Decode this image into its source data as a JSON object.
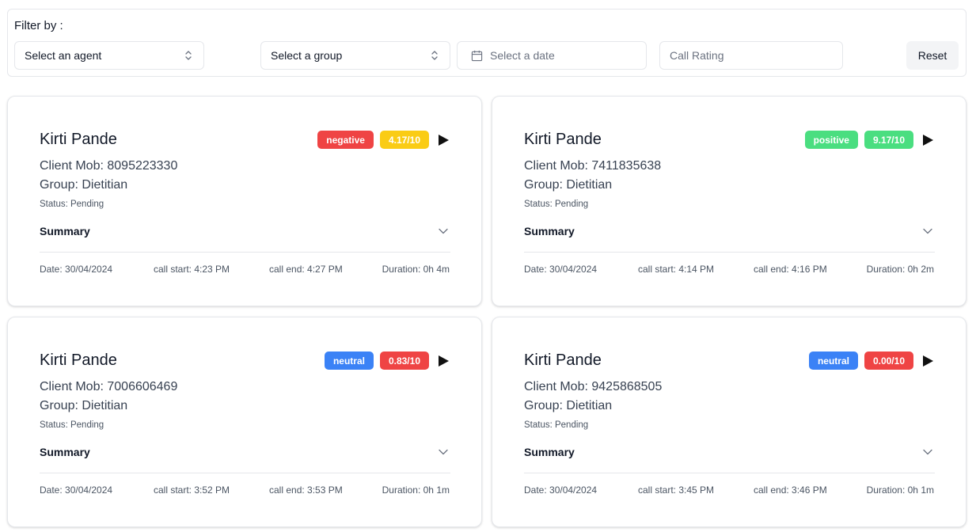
{
  "filters": {
    "label": "Filter by :",
    "agent_select": "Select an agent",
    "group_select": "Select a group",
    "date_placeholder": "Select a date",
    "rating_placeholder": "Call Rating",
    "reset_label": "Reset"
  },
  "colors": {
    "negative": "#ef4444",
    "positive": "#4ade80",
    "neutral": "#3b82f6",
    "rating_mid": "#facc15",
    "rating_high": "#4ade80",
    "rating_low": "#ef4444"
  },
  "cards": [
    {
      "name": "Kirti Pande",
      "mobile": "Client Mob: 8095223330",
      "group": "Group: Dietitian",
      "status": "Status: Pending",
      "summary_label": "Summary",
      "sentiment": "negative",
      "rating": "4.17/10",
      "date": "Date: 30/04/2024",
      "call_start": "call start: 4:23 PM",
      "call_end": "call end: 4:27 PM",
      "duration": "Duration: 0h 4m"
    },
    {
      "name": "Kirti Pande",
      "mobile": "Client Mob: 7411835638",
      "group": "Group: Dietitian",
      "status": "Status: Pending",
      "summary_label": "Summary",
      "sentiment": "positive",
      "rating": "9.17/10",
      "date": "Date: 30/04/2024",
      "call_start": "call start: 4:14 PM",
      "call_end": "call end: 4:16 PM",
      "duration": "Duration: 0h 2m"
    },
    {
      "name": "Kirti Pande",
      "mobile": "Client Mob: 7006606469",
      "group": "Group: Dietitian",
      "status": "Status: Pending",
      "summary_label": "Summary",
      "sentiment": "neutral",
      "rating": "0.83/10",
      "date": "Date: 30/04/2024",
      "call_start": "call start: 3:52 PM",
      "call_end": "call end: 3:53 PM",
      "duration": "Duration: 0h 1m"
    },
    {
      "name": "Kirti Pande",
      "mobile": "Client Mob: 9425868505",
      "group": "Group: Dietitian",
      "status": "Status: Pending",
      "summary_label": "Summary",
      "sentiment": "neutral",
      "rating": "0.00/10",
      "date": "Date: 30/04/2024",
      "call_start": "call start: 3:45 PM",
      "call_end": "call end: 3:46 PM",
      "duration": "Duration: 0h 1m"
    }
  ]
}
